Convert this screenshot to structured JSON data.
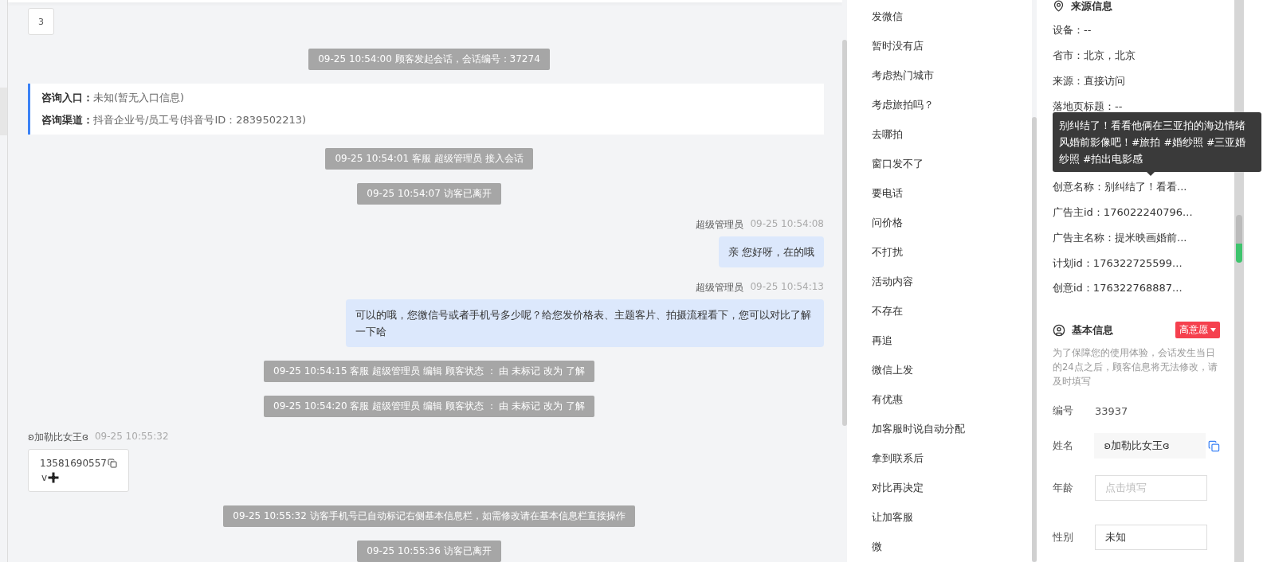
{
  "chat": {
    "page_badge": "3",
    "messages": [
      {
        "kind": "system",
        "text": "09-25 10:54:00 顾客发起会话，会话编号：37274"
      },
      {
        "kind": "info",
        "rows": [
          {
            "label": "咨询入口：",
            "value": "未知(暂无入口信息)"
          },
          {
            "label": "咨询渠道：",
            "value": "抖音企业号/员工号(抖音号ID：2839502213)"
          }
        ]
      },
      {
        "kind": "system",
        "text": "09-25 10:54:01 客服 超级管理员 接入会话"
      },
      {
        "kind": "system",
        "text": "09-25 10:54:07 访客已离开"
      },
      {
        "kind": "agent",
        "sender": "超级管理员",
        "time": "09-25 10:54:08",
        "text": "亲 您好呀，在的哦"
      },
      {
        "kind": "agent",
        "sender": "超级管理员",
        "time": "09-25 10:54:13",
        "text": "可以的哦，您微信号或者手机号多少呢？给您发价格表、主题客片、拍摄流程看下，您可以对比了解一下哈"
      },
      {
        "kind": "system",
        "text": "09-25 10:54:15 客服 超级管理员 编辑 顾客状态 ： 由 未标记 改为 了解"
      },
      {
        "kind": "system",
        "text": "09-25 10:54:20 客服 超级管理员 编辑 顾客状态 ： 由 未标记 改为 了解"
      },
      {
        "kind": "visitor",
        "sender": "ʚ加勒比女王ɞ",
        "time": "09-25 10:55:32",
        "phone": "13581690557",
        "suffix": "v"
      },
      {
        "kind": "system",
        "text": "09-25 10:55:32 访客手机号已自动标记右侧基本信息栏，如需修改请在基本信息栏直接操作"
      },
      {
        "kind": "system",
        "text": "09-25 10:55:36 访客已离开"
      }
    ]
  },
  "quick_replies": [
    "发微信",
    "暂时没有店",
    "考虑热门城市",
    "考虑旅拍吗？",
    "去哪拍",
    "窗口发不了",
    "要电话",
    "问价格",
    "不打扰",
    "活动内容",
    "不存在",
    "再追",
    "微信上发",
    "有优惠",
    "加客服时说自动分配",
    "拿到联系后",
    "对比再决定",
    "让加客服",
    "微"
  ],
  "source_info": {
    "title": "来源信息",
    "rows_top": [
      "设备：--",
      "省市：北京，北京",
      "来源：直接访问",
      "落地页标题：--"
    ],
    "tooltip": "别纠结了！看看他俩在三亚拍的海边情绪风婚前影像吧！#旅拍 #婚纱照 #三亚婚纱照 #拍出电影感",
    "rows_bottom": [
      "创意名称：别纠结了！看看...",
      "广告主id：176022240796...",
      "广告主名称：提米映画婚前...",
      "计划id：176322725599...",
      "创意id：176322768887..."
    ]
  },
  "basic_info": {
    "title": "基本信息",
    "intent_tag": "高意愿",
    "note": "为了保障您的使用体验，会话发生当日的24点之后，顾客信息将无法修改，请及时填写",
    "fields": [
      {
        "kind": "text",
        "label": "编号",
        "value": "33937"
      },
      {
        "kind": "copy",
        "label": "姓名",
        "value": "ʚ加勒比女王ɞ"
      },
      {
        "kind": "input",
        "label": "年龄",
        "placeholder": "点击填写"
      },
      {
        "kind": "input",
        "label": "性别",
        "value": "未知"
      }
    ]
  }
}
